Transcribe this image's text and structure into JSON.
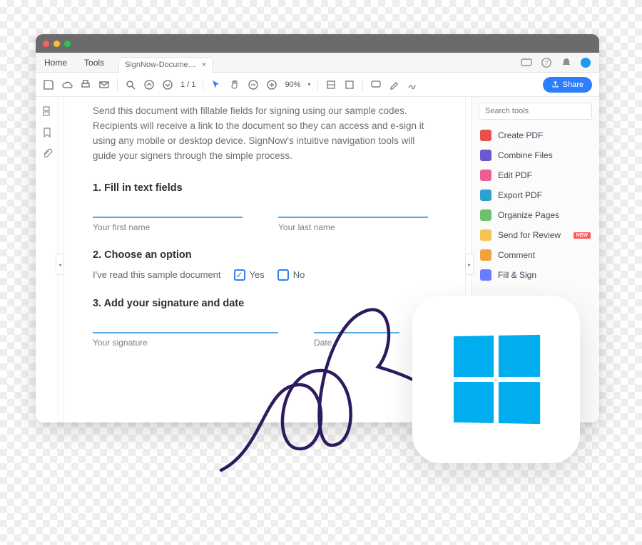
{
  "menu": {
    "home": "Home",
    "tools": "Tools",
    "tab": "SignNow-Docume…",
    "close": "×"
  },
  "toolbar": {
    "page_current": "1",
    "page_sep": "/",
    "page_total": "1",
    "zoom": "90%",
    "share": "Share"
  },
  "doc": {
    "intro": "Send this document with fillable fields for signing using our sample codes. Recipients will receive a link to the document so they can access and e-sign it using any mobile or desktop device. SignNow's intuitive navigation tools will guide your signers through the simple process.",
    "sec1": "1. Fill in text fields",
    "first_name": "Your first name",
    "last_name": "Your last name",
    "sec2": "2. Choose an option",
    "read_lead": "I've read this sample document",
    "yes": "Yes",
    "no": "No",
    "sec3": "3. Add your signature and date",
    "sig": "Your signature",
    "date": "Date"
  },
  "right": {
    "search_ph": "Search tools",
    "items": [
      {
        "label": "Create PDF",
        "color": "#e94f4f"
      },
      {
        "label": "Combine Files",
        "color": "#6b57d1"
      },
      {
        "label": "Edit PDF",
        "color": "#ec5d93"
      },
      {
        "label": "Export PDF",
        "color": "#2aa3d2"
      },
      {
        "label": "Organize Pages",
        "color": "#6dc16d"
      },
      {
        "label": "Send for Review",
        "color": "#f6c453",
        "new": "NEW"
      },
      {
        "label": "Comment",
        "color": "#f2a33c"
      },
      {
        "label": "Fill & Sign",
        "color": "#6b7cff"
      }
    ]
  }
}
